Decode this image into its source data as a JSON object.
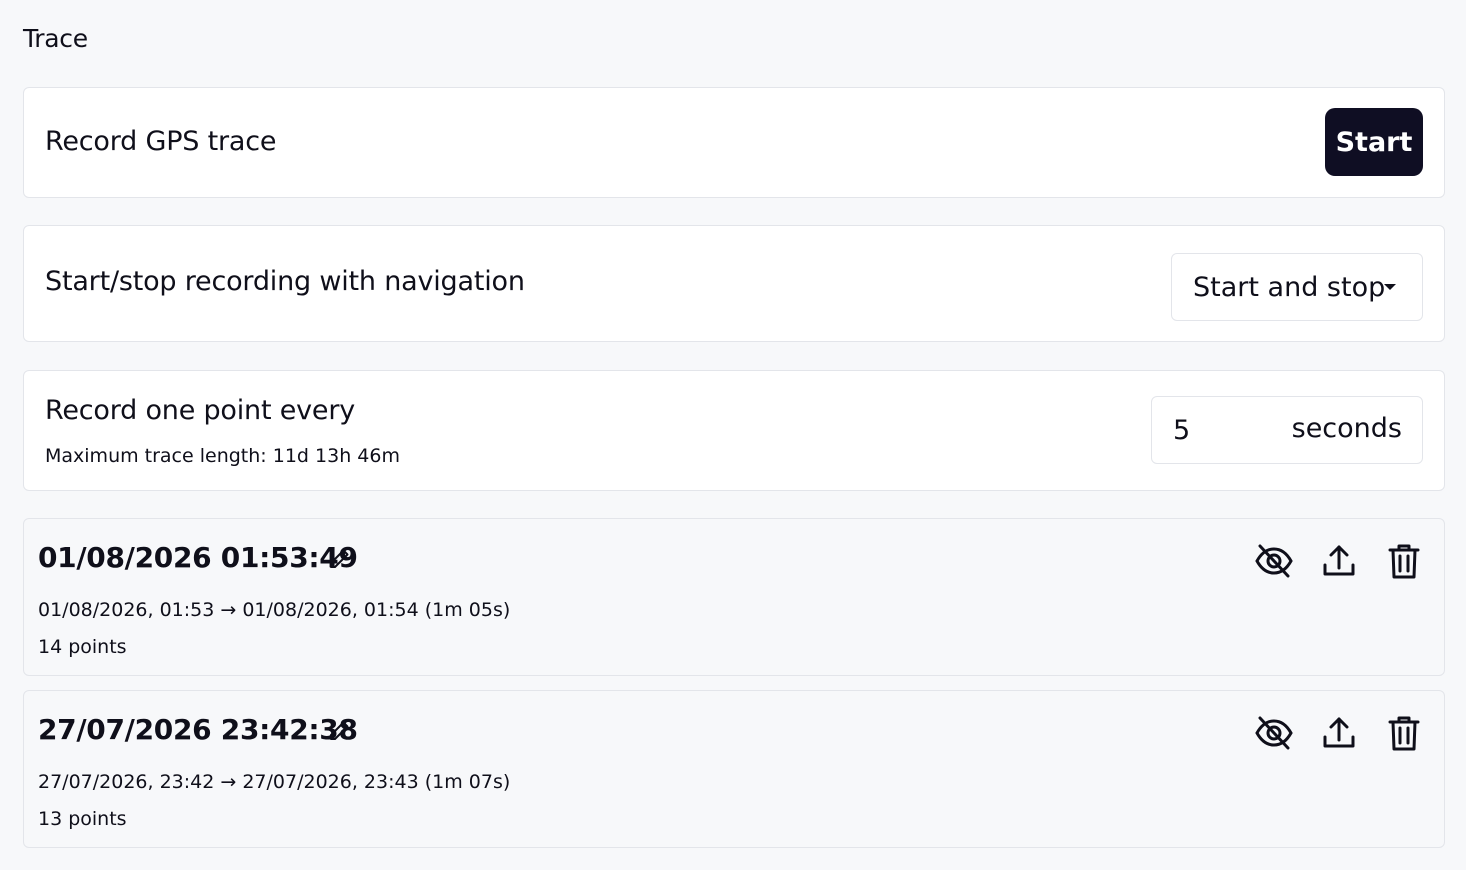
{
  "page": {
    "title": "Trace"
  },
  "record": {
    "label": "Record GPS trace",
    "button_label": "Start"
  },
  "navigation": {
    "label": "Start/stop recording with navigation",
    "selected_option": "Start and stop"
  },
  "interval": {
    "label": "Record one point every",
    "value": "5",
    "unit": "seconds",
    "hint": "Maximum trace length: 11d 13h 46m"
  },
  "traces": [
    {
      "name": "01/08/2026 01:53:49",
      "range": "01/08/2026, 01:53 → 01/08/2026, 01:54 (1m 05s)",
      "points": "14 points"
    },
    {
      "name": "27/07/2026 23:42:38",
      "range": "27/07/2026, 23:42 → 27/07/2026, 23:43 (1m 07s)",
      "points": "13 points"
    }
  ],
  "icons": {
    "edit": "pencil-icon",
    "visibility": "eye-off-icon",
    "export": "upload-icon",
    "delete": "trash-icon"
  },
  "colors": {
    "primary_button": "#0f0e23",
    "background": "#f7f8fa",
    "card": "#ffffff",
    "border": "#e3e5ea"
  }
}
